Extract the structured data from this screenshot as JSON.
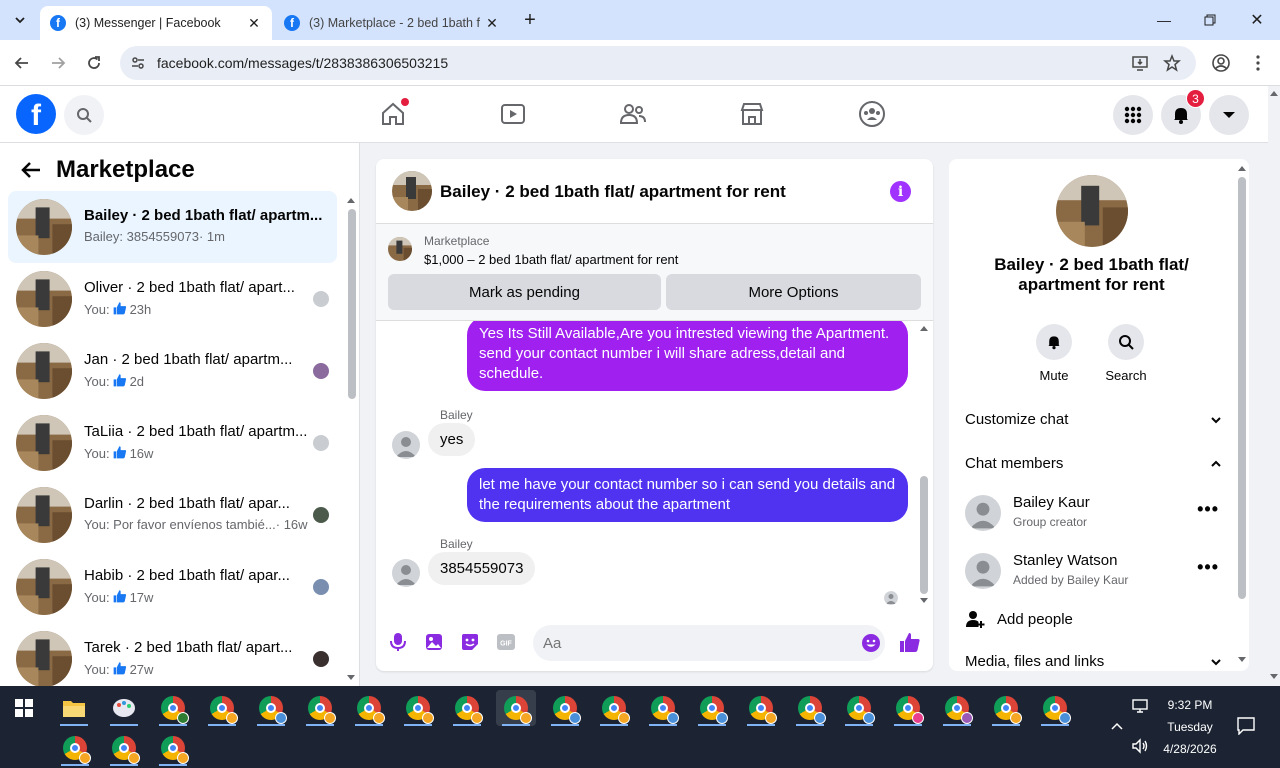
{
  "browser": {
    "tabs": [
      {
        "title": "(3) Messenger | Facebook",
        "active": true
      },
      {
        "title": "(3) Marketplace - 2 bed 1bath f",
        "active": false
      }
    ],
    "url": "facebook.com/messages/t/2838386306503215"
  },
  "fb": {
    "logo_letter": "f",
    "notifications_count": "3"
  },
  "left": {
    "title": "Marketplace",
    "conversations": [
      {
        "name": "Bailey · 2 bed 1bath flat/ apartm...",
        "prefix": "Bailey: 3854559073",
        "time": " · 1m",
        "like": false,
        "selected": true
      },
      {
        "name": "Oliver · 2 bed 1bath flat/ apart...",
        "prefix": "You:",
        "time": "23h",
        "like": true
      },
      {
        "name": "Jan · 2 bed 1bath flat/ apartm...",
        "prefix": "You:",
        "time": "2d",
        "like": true
      },
      {
        "name": "TaLiia · 2 bed 1bath flat/ apartm...",
        "prefix": "You:",
        "time": "16w",
        "like": true
      },
      {
        "name": "Darlin · 2 bed 1bath flat/ apar...",
        "prefix": "You: Por favor envíenos tambié...",
        "time": " · 16w",
        "like": false
      },
      {
        "name": "Habib · 2 bed 1bath flat/ apar...",
        "prefix": "You:",
        "time": "17w",
        "like": true
      },
      {
        "name": "Tarek · 2 bed 1bath flat/ apart...",
        "prefix": "You:",
        "time": "27w",
        "like": true
      }
    ]
  },
  "chat": {
    "title": "Bailey · 2 bed 1bath flat/ apartment for rent",
    "marketplace_label": "Marketplace",
    "listing": "$1,000 – 2 bed 1bath flat/ apartment for rent",
    "mark_pending": "Mark as pending",
    "more_options": "More Options",
    "messages": {
      "out1": "Yes Its Still Available,Are you intrested viewing the Apartment. send your contact number i will share adress,detail and schedule.",
      "sender1": "Bailey",
      "in1": "yes",
      "out2": "let me have your contact number so i can send you details and the requirements about the apartment",
      "sender2": "Bailey",
      "in2": "3854559073"
    },
    "input_placeholder": "Aa",
    "colors": {
      "out1": "#a020f0",
      "out2": "#5033f0",
      "accent": "#8a2be2"
    }
  },
  "right": {
    "name": "Bailey · 2 bed 1bath flat/ apartment for rent",
    "mute": "Mute",
    "search": "Search",
    "customize": "Customize chat",
    "members_title": "Chat members",
    "members": [
      {
        "name": "Bailey Kaur",
        "role": "Group creator"
      },
      {
        "name": "Stanley Watson",
        "role": "Added by Bailey Kaur"
      }
    ],
    "add_people": "Add people",
    "media": "Media, files and links"
  },
  "taskbar": {
    "time": "9:32 PM",
    "day": "Tuesday",
    "date": "4/28/2026"
  }
}
